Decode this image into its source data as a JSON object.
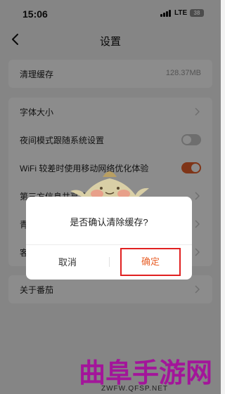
{
  "status_bar": {
    "time": "15:06",
    "network": "LTE",
    "battery": "38"
  },
  "header": {
    "title": "设置"
  },
  "settings": {
    "cache": {
      "label": "清理缓存",
      "value": "128.37MB"
    },
    "font_size": {
      "label": "字体大小"
    },
    "night_mode": {
      "label": "夜间模式跟随系统设置",
      "enabled": false
    },
    "wifi_mobile": {
      "label": "WiFi 较差时使用移动网络优化体验",
      "enabled": true
    },
    "third_party": {
      "label": "第三方信息共享清单"
    },
    "row_qing": {
      "label": "青"
    },
    "row_ke": {
      "label": "客"
    },
    "about": {
      "label": "关于番茄"
    }
  },
  "dialog": {
    "message": "是否确认清除缓存?",
    "cancel": "取消",
    "confirm": "确定"
  },
  "watermark": {
    "title": "曲阜手游网",
    "url": "ZWFW.QFSP.NET"
  },
  "colors": {
    "accent": "#e8622c",
    "highlight_border": "#e02020",
    "watermark": "#a3159a"
  }
}
